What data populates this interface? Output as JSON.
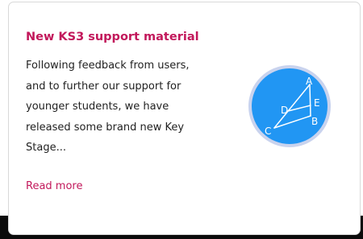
{
  "colors": {
    "title": "#c2185b",
    "link": "#c2185b",
    "badge_fill": "#2196f3",
    "badge_ring": "#c9d3ee",
    "badge_lines": "#ffffff",
    "card_border": "#d9d9d9",
    "bottom_strip": "#0b0b0b"
  },
  "card": {
    "title": "New KS3 support material",
    "body_lines": [
      "Following feedback from users,",
      "and to further our support for",
      "younger students, we have",
      "released some brand new Key",
      "Stage..."
    ],
    "read_more_label": "Read more",
    "badge": {
      "icon": "geometry-triangle-icon",
      "labels": {
        "a": "A",
        "b": "B",
        "c": "C",
        "d": "D",
        "e": "E"
      }
    }
  }
}
